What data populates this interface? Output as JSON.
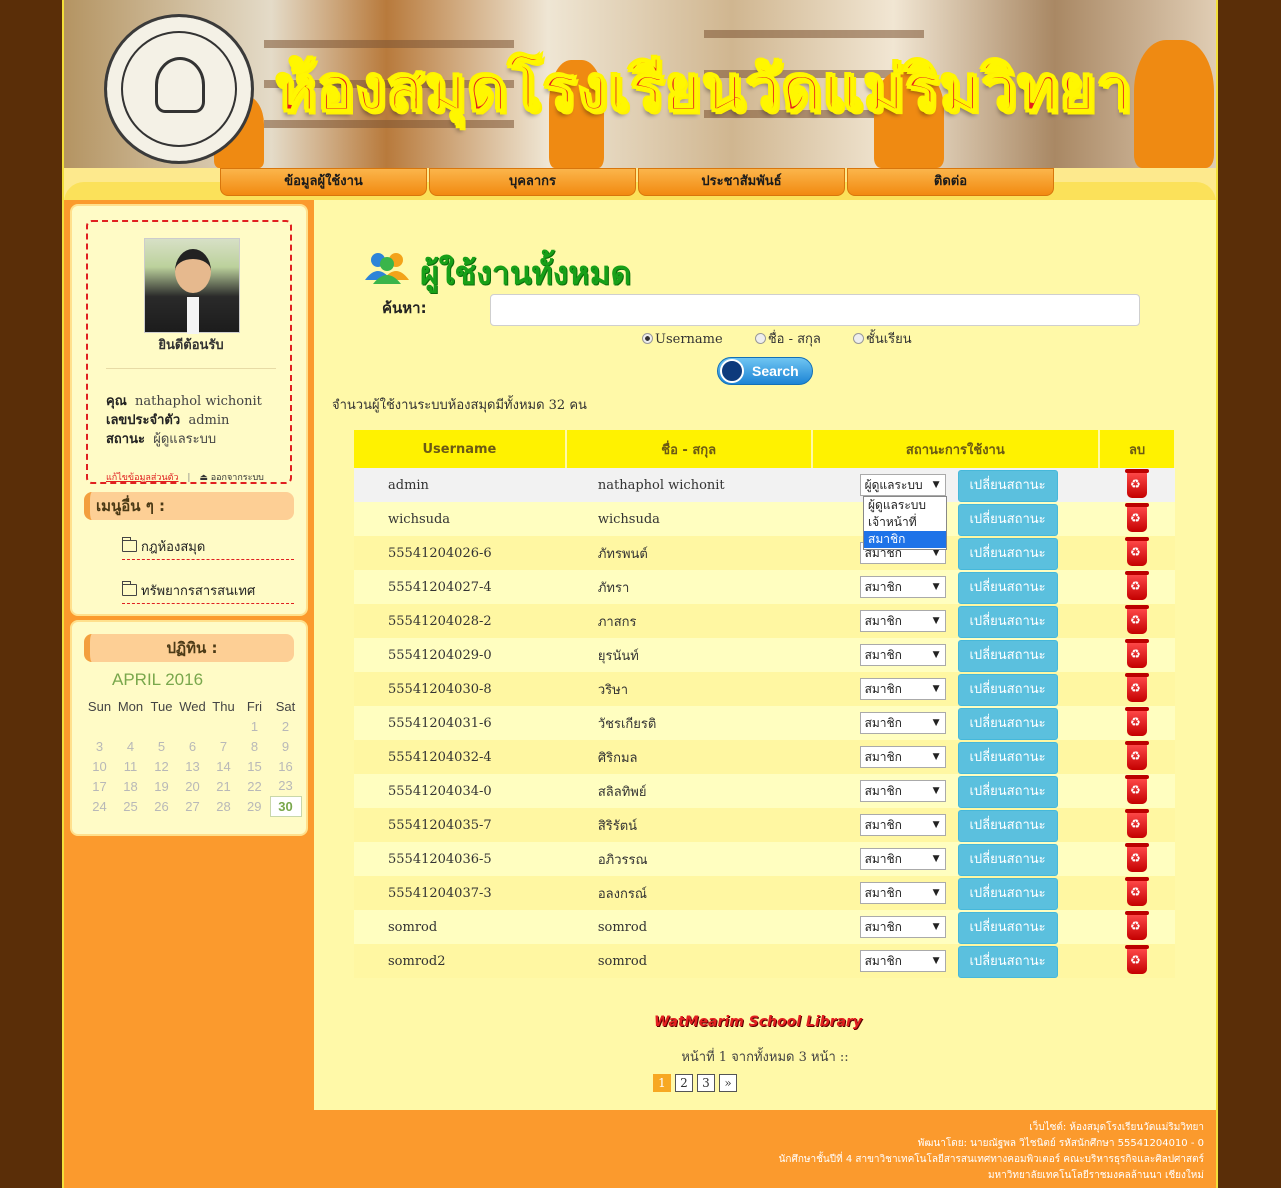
{
  "header": {
    "title": "ห้องสมุดโรงเรียนวัดแม่ริมวิทยา"
  },
  "nav": {
    "items": [
      "ข้อมูลผู้ใช้งาน",
      "บุคลากร",
      "ประชาสัมพันธ์",
      "ติดต่อ"
    ]
  },
  "profile": {
    "welcome": "ยินดีต้อนรับ",
    "name_label": "คุณ",
    "name": "nathaphol wichonit",
    "id_label": "เลขประจำตัว",
    "id": "admin",
    "status_label": "สถานะ",
    "status": "ผู้ดูแลระบบ",
    "edit_link": "แก้ไขข้อมูลส่วนตัว",
    "logout_link": "ออกจากระบบ"
  },
  "menu": {
    "title": "เมนูอื่น ๆ :",
    "items": [
      "กฎห้องสมุด",
      "ทรัพยากรสารสนเทศ"
    ]
  },
  "calendar": {
    "title": "ปฏิทิน :",
    "month": "APRIL 2016",
    "days": [
      "Sun",
      "Mon",
      "Tue",
      "Wed",
      "Thu",
      "Fri",
      "Sat"
    ],
    "weeks": [
      [
        "",
        "",
        "",
        "",
        "",
        "1",
        "2"
      ],
      [
        "3",
        "4",
        "5",
        "6",
        "7",
        "8",
        "9"
      ],
      [
        "10",
        "11",
        "12",
        "13",
        "14",
        "15",
        "16"
      ],
      [
        "17",
        "18",
        "19",
        "20",
        "21",
        "22",
        "23"
      ],
      [
        "24",
        "25",
        "26",
        "27",
        "28",
        "29",
        "30"
      ]
    ],
    "today": "30"
  },
  "main": {
    "title": "ผู้ใช้งานทั้งหมด",
    "search_label": "ค้นหา:",
    "search_value": "",
    "radio_options": [
      "Username",
      "ชื่อ - สกุล",
      "ชั้นเรียน"
    ],
    "radio_selected": "Username",
    "search_button": "Search",
    "count_text": "จำนวนผู้ใช้งานระบบห้องสมุดมีทั้งหมด 32 คน"
  },
  "table": {
    "headers": [
      "Username",
      "ชื่อ - สกุล",
      "สถานะการใช้งาน",
      "ลบ"
    ],
    "change_label": "เปลี่ยนสถานะ",
    "rows": [
      {
        "username": "admin",
        "name": "nathaphol wichonit",
        "status": "ผู้ดูแลระบบ"
      },
      {
        "username": "wichsuda",
        "name": "wichsuda",
        "status": ""
      },
      {
        "username": "55541204026-6",
        "name": "ภัทรพนต์",
        "status": "สมาชิก"
      },
      {
        "username": "55541204027-4",
        "name": "ภัทรา",
        "status": "สมาชิก"
      },
      {
        "username": "55541204028-2",
        "name": "ภาสกร",
        "status": "สมาชิก"
      },
      {
        "username": "55541204029-0",
        "name": "ยุรนันท์",
        "status": "สมาชิก"
      },
      {
        "username": "55541204030-8",
        "name": "วริษา",
        "status": "สมาชิก"
      },
      {
        "username": "55541204031-6",
        "name": "วัชรเกียรติ",
        "status": "สมาชิก"
      },
      {
        "username": "55541204032-4",
        "name": "ศิริกมล",
        "status": "สมาชิก"
      },
      {
        "username": "55541204034-0",
        "name": "สลิลทิพย์",
        "status": "สมาชิก"
      },
      {
        "username": "55541204035-7",
        "name": "สิริรัตน์",
        "status": "สมาชิก"
      },
      {
        "username": "55541204036-5",
        "name": "อภิวรรณ",
        "status": "สมาชิก"
      },
      {
        "username": "55541204037-3",
        "name": "อลงกรณ์",
        "status": "สมาชิก"
      },
      {
        "username": "somrod",
        "name": "somrod",
        "status": "สมาชิก"
      },
      {
        "username": "somrod2",
        "name": "somrod",
        "status": "สมาชิก"
      }
    ]
  },
  "dropdown": {
    "options": [
      "ผู้ดูแลระบบ",
      "เจ้าหน้าที่",
      "สมาชิก"
    ],
    "highlighted": "สมาชิก"
  },
  "footer_logo": "WatMearim School Library",
  "pagination": {
    "info": "หน้าที่ 1 จากทั้งหมด 3 หน้า ::",
    "pages": [
      "1",
      "2",
      "3",
      "»"
    ],
    "current": "1"
  },
  "footer": {
    "lines": [
      "เว็บไซต์: ห้องสมุดโรงเรียนวัดแม่ริมวิทยา",
      "พัฒนาโดย: นายณัฐพล วิไชนิตย์ รหัสนักศึกษา 55541204010 - 0",
      "นักศึกษาชั้นปีที่ 4 สาขาวิชาเทคโนโลยีสารสนเทศทางคอมพิวเตอร์ คณะบริหารธุรกิจและศิลปศาสตร์",
      "มหาวิทยาลัยเทคโนโลยีราชมงคลล้านนา เชียงใหม่"
    ]
  },
  "colors": {
    "brown_bg": "#5a2e08",
    "orange": "#fb9a2d",
    "yellow": "#fff200",
    "button_blue": "#5bc0de",
    "title_green": "#18a018",
    "title_red": "#e61e1e"
  }
}
